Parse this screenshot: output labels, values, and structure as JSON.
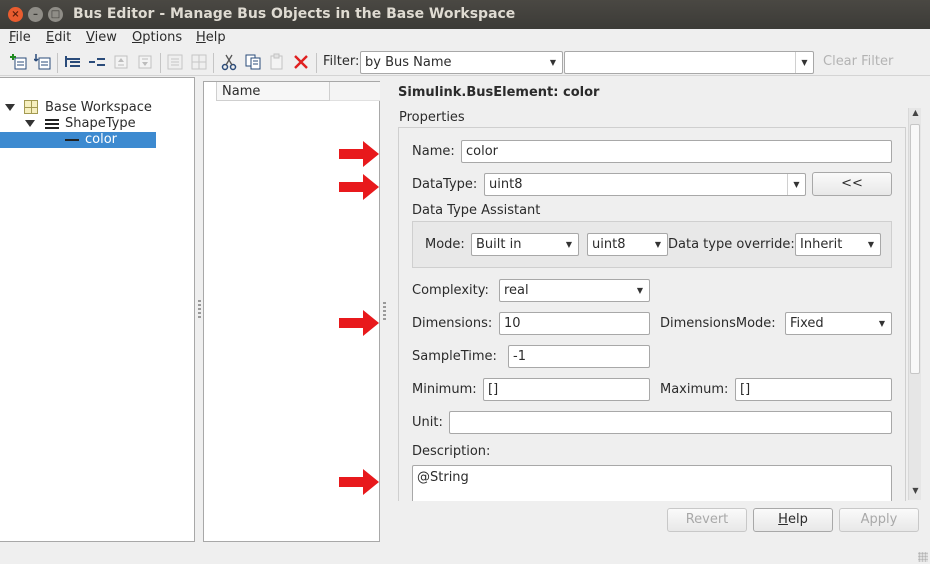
{
  "window": {
    "title": "Bus Editor - Manage Bus Objects in the Base Workspace",
    "close": "×",
    "minimize": "–",
    "maximize": "□"
  },
  "menu": [
    {
      "label": "File",
      "mnemonic": "F",
      "rest": "ile"
    },
    {
      "label": "Edit",
      "mnemonic": "E",
      "rest": "dit"
    },
    {
      "label": "View",
      "mnemonic": "V",
      "rest": "iew"
    },
    {
      "label": "Options",
      "mnemonic": "O",
      "rest": "ptions"
    },
    {
      "label": "Help",
      "mnemonic": "H",
      "rest": "elp"
    }
  ],
  "toolbar": {
    "filter_label": "Filter:",
    "filter_by": "by Bus Name",
    "filter_text": "",
    "clear_filter": "Clear Filter",
    "icons": [
      "add-bus-icon",
      "add-bus-below-icon",
      "insert-element-icon",
      "create-element-icon",
      "move-up-icon",
      "move-down-icon",
      "bus-connector-icon",
      "bus-grid-icon",
      "cut-icon",
      "copy-icon",
      "paste-icon",
      "delete-icon"
    ]
  },
  "tree": {
    "root": "Base Workspace",
    "bus": "ShapeType",
    "element": "color"
  },
  "list": {
    "header": "Name"
  },
  "properties": {
    "title": "Simulink.BusElement: color",
    "section": "Properties",
    "name_label": "Name:",
    "name_value": "color",
    "datatype_label": "DataType:",
    "datatype_value": "uint8",
    "assistant_toggle": "<<",
    "assistant_title": "Data Type Assistant",
    "mode_label": "Mode:",
    "mode_value": "Built in",
    "builtin_type": "uint8",
    "override_label": "Data type override:",
    "override_value": "Inherit",
    "complexity_label": "Complexity:",
    "complexity_value": "real",
    "dimensions_label": "Dimensions:",
    "dimensions_value": "10",
    "dimmode_label": "DimensionsMode:",
    "dimmode_value": "Fixed",
    "sampletime_label": "SampleTime:",
    "sampletime_value": "-1",
    "minimum_label": "Minimum:",
    "minimum_value": "[]",
    "maximum_label": "Maximum:",
    "maximum_value": "[]",
    "unit_label": "Unit:",
    "unit_value": "",
    "description_label": "Description:",
    "description_value": "@String"
  },
  "buttons": {
    "revert": "Revert",
    "help": "Help",
    "help_mnemonic": "H",
    "help_rest": "elp",
    "apply": "Apply"
  },
  "colors": {
    "selection": "#3d8ad0",
    "annotation_arrow": "#e8191c",
    "titlebar": "#3c3b37",
    "close_button": "#e95c2f"
  }
}
